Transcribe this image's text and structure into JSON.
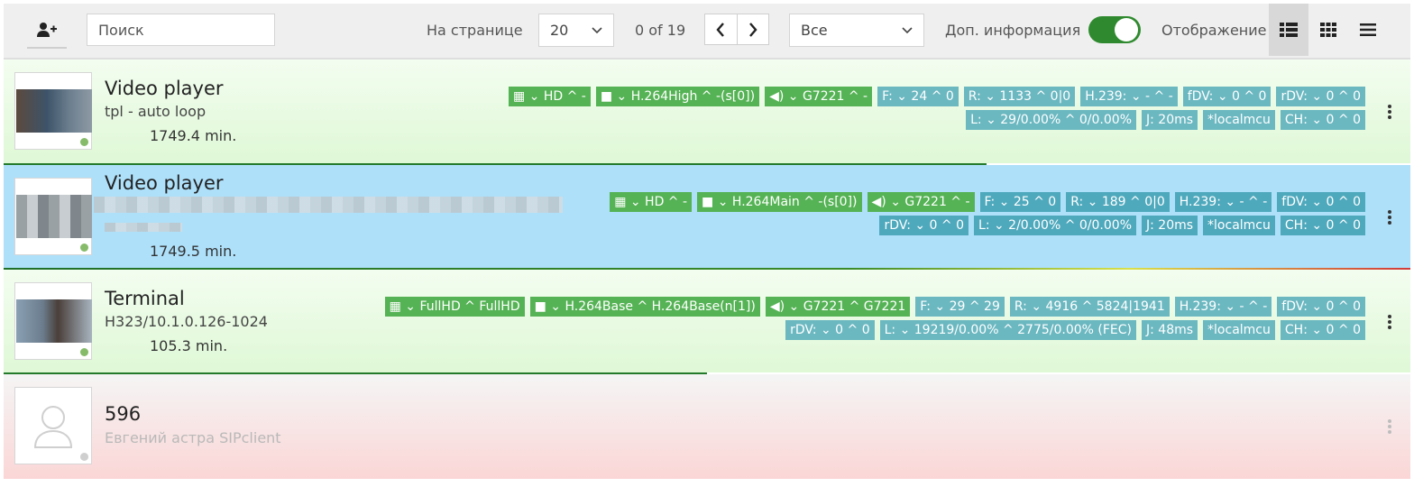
{
  "toolbar": {
    "search_placeholder": "Поиск",
    "per_page_label": "На странице",
    "per_page_value": "20",
    "count_text": "0 of 19",
    "filter_value": "Все",
    "extra_info_label": "Доп. информация",
    "extra_info_on": true,
    "view_label": "Отображение",
    "active_view": "details"
  },
  "colors": {
    "accent_green": "#2f8a2f",
    "badge_green": "#55b355",
    "badge_teal": "#6bb8c1",
    "row_selected": "#aee0fa"
  },
  "rows": [
    {
      "name": "Video player",
      "subtitle": "tpl - auto loop",
      "duration": "1749.4 min.",
      "badges_main": [
        "HD ^ -",
        "H.264High ^ -(s[0])",
        "G7221 ^ -"
      ],
      "badges_stats": [
        "F: ⌄ 24 ^ 0",
        "R: ⌄ 1133 ^ 0|0",
        "H.239: ⌄ - ^ -",
        "fDV: ⌄ 0 ^ 0",
        "rDV: ⌄ 0 ^ 0",
        "L: ⌄ 29/0.00% ^ 0/0.00%",
        "J: 20ms",
        "*localmcu",
        "CH: ⌄ 0 ^ 0"
      ]
    },
    {
      "name": "Video player",
      "subtitle": "",
      "duration": "1749.5 min.",
      "badges_main": [
        "HD ^ -",
        "H.264Main ^ -(s[0])",
        "G7221 ^ -"
      ],
      "badges_stats": [
        "F: ⌄ 25 ^ 0",
        "R: ⌄ 189 ^ 0|0",
        "H.239: ⌄ - ^ -",
        "fDV: ⌄ 0 ^ 0",
        "rDV: ⌄ 0 ^ 0",
        "L: ⌄ 2/0.00% ^ 0/0.00%",
        "J: 20ms",
        "*localmcu",
        "CH: ⌄ 0 ^ 0"
      ]
    },
    {
      "name": "Terminal",
      "subtitle": "H323/10.1.0.126-1024",
      "duration": "105.3 min.",
      "badges_main": [
        "FullHD ^ FullHD",
        "H.264Base ^ H.264Base(n[1])",
        "G7221 ^ G7221"
      ],
      "badges_stats": [
        "F: ⌄ 29 ^ 29",
        "R: ⌄ 4916 ^ 5824|1941",
        "H.239: ⌄ - ^ -",
        "fDV: ⌄ 0 ^ 0",
        "rDV: ⌄ 0 ^ 0",
        "L: ⌄ 19219/0.00% ^ 2775/0.00% (FEC)",
        "J: 48ms",
        "*localmcu",
        "CH: ⌄ 0 ^ 0"
      ]
    },
    {
      "name": "596",
      "subtitle": "Евгений астра SIPclient",
      "duration": ""
    }
  ]
}
